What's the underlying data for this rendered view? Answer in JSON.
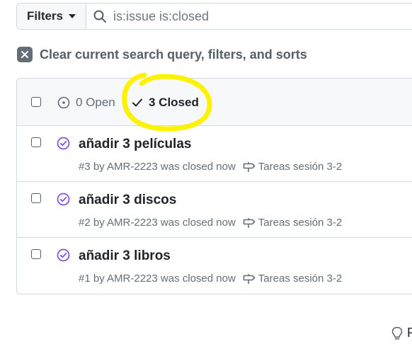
{
  "filters": {
    "button_label": "Filters"
  },
  "search": {
    "value": "is:issue is:closed"
  },
  "clear": {
    "label": "Clear current search query, filters, and sorts"
  },
  "states": {
    "open_label": "0 Open",
    "closed_label": "3 Closed"
  },
  "issues": [
    {
      "title": "añadir 3 películas",
      "meta": "#3 by AMR-2223 was closed now",
      "milestone": "Tareas sesión 3-2"
    },
    {
      "title": "añadir 3 discos",
      "meta": "#2 by AMR-2223 was closed now",
      "milestone": "Tareas sesión 3-2"
    },
    {
      "title": "añadir 3 libros",
      "meta": "#1 by AMR-2223 was closed now",
      "milestone": "Tareas sesión 3-2"
    }
  ],
  "tip": {
    "text": "P"
  },
  "colors": {
    "closed_icon": "#8250df",
    "highlight": "#fff200"
  }
}
